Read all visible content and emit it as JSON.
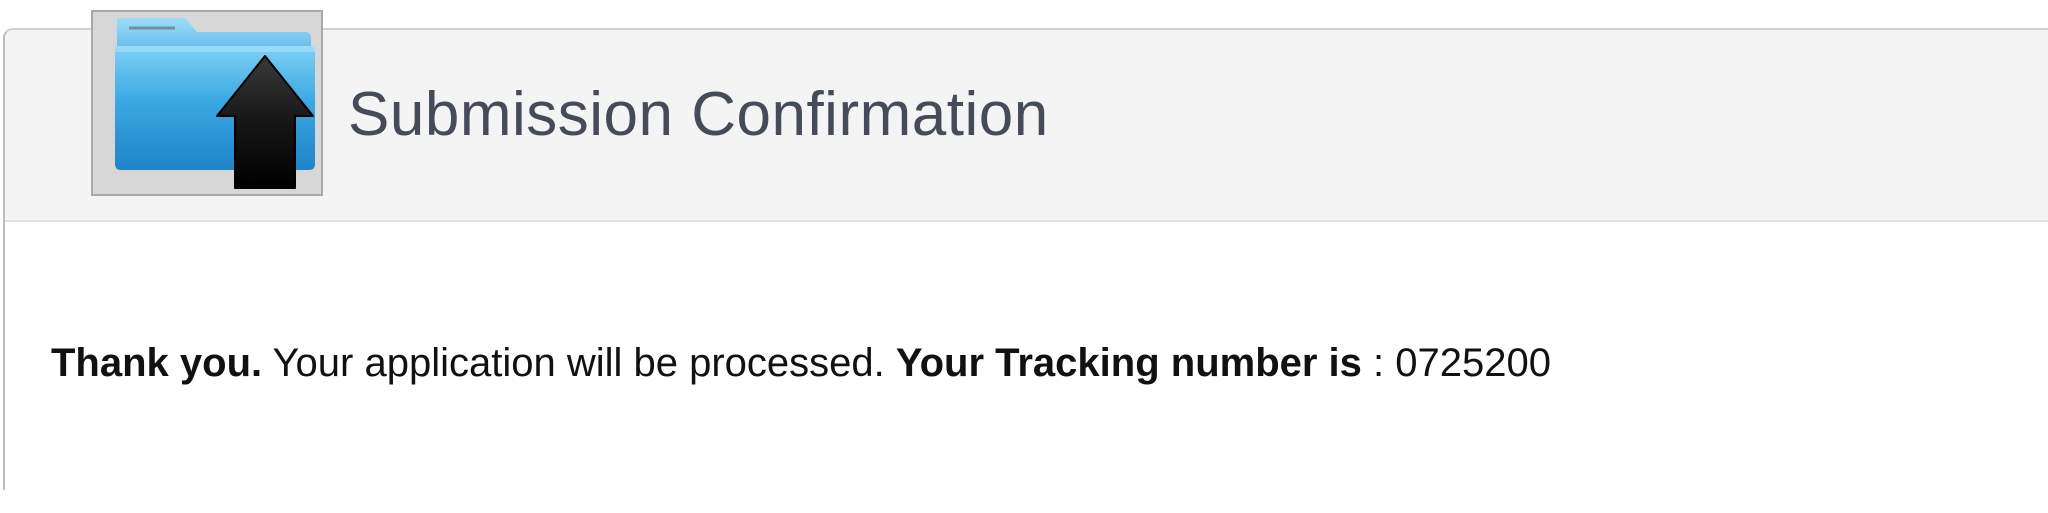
{
  "header": {
    "title": "Submission Confirmation",
    "icon": "folder-upload-icon"
  },
  "message": {
    "thank_you": "Thank you.",
    "processed_text": " Your application will be processed. ",
    "tracking_label": "Your Tracking number is",
    "separator": " : ",
    "tracking_number": "0725200"
  },
  "colors": {
    "header_background": "#f4f4f4",
    "title_text": "#454b57",
    "folder_blue": "#39a7e2",
    "arrow_black": "#111111"
  }
}
